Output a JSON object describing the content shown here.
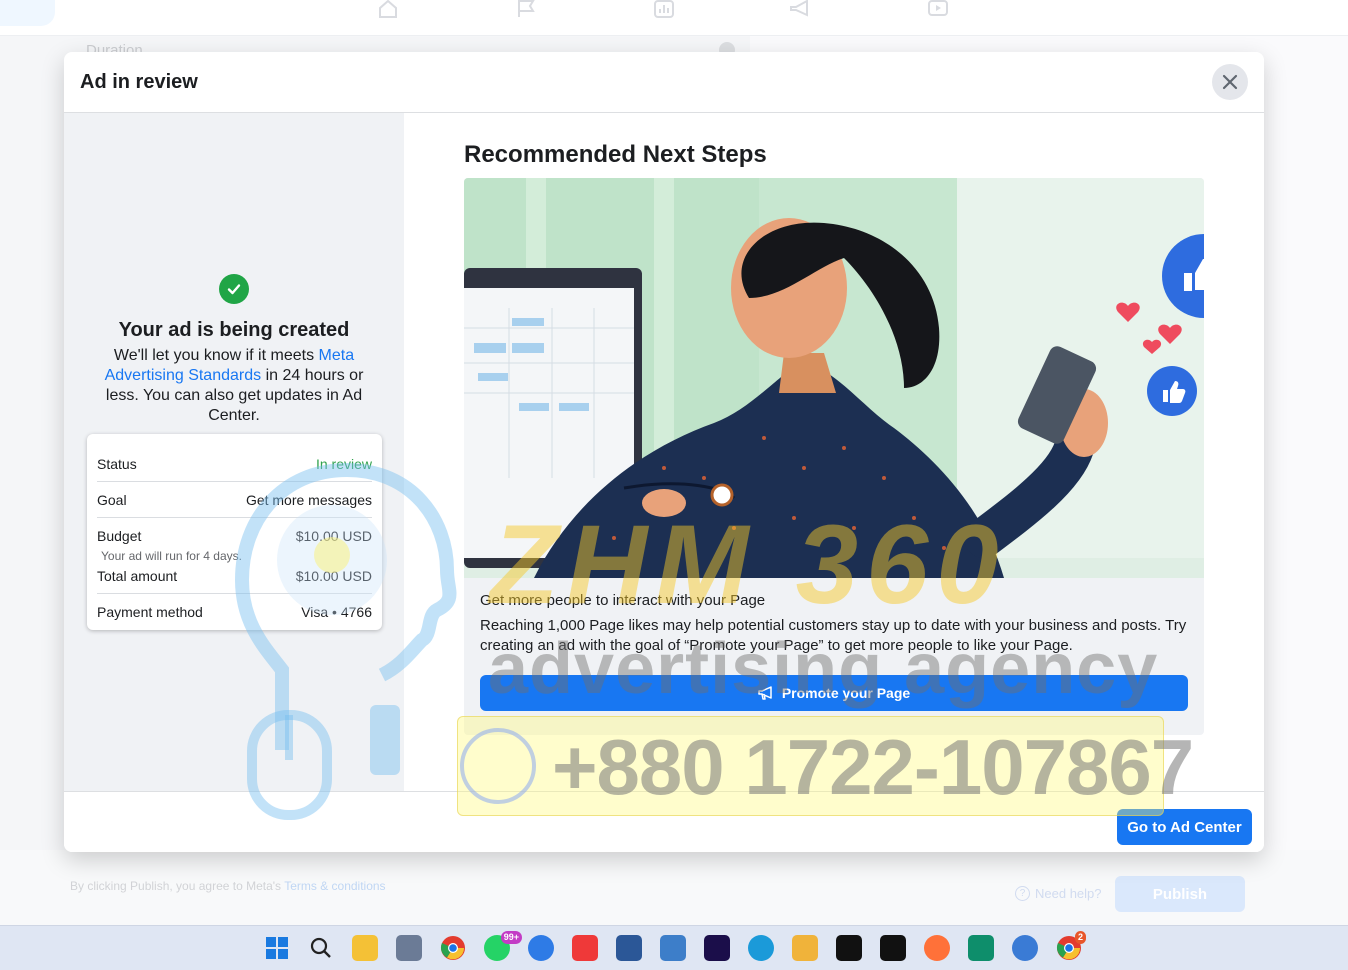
{
  "background": {
    "duration_label": "Duration",
    "terms_prefix": "By clicking Publish, you agree to Meta's ",
    "terms_link": "Terms & conditions",
    "need_help": "Need help?",
    "publish_label": "Publish"
  },
  "modal": {
    "title": "Ad in review",
    "confirmation": {
      "title": "Your ad is being created",
      "desc_before": "We'll let you know if it meets ",
      "desc_link": "Meta Advertising Standards",
      "desc_after": " in 24 hours or less. You can also get updates in Ad Center."
    },
    "summary": {
      "status_label": "Status",
      "status_value": "In review",
      "goal_label": "Goal",
      "goal_value": "Get more messages",
      "budget_label": "Budget",
      "budget_value": "$10.00 USD",
      "budget_note": "Your ad will run for 4 days.",
      "total_label": "Total amount",
      "total_value": "$10.00 USD",
      "payment_label": "Payment method",
      "payment_value": "Visa • 4766"
    },
    "next_steps": {
      "title": "Recommended Next Steps",
      "card_heading": "Get more people to interact with your Page",
      "card_body": "Reaching 1,000 Page likes may help potential customers stay up to date with your business and posts. Try creating an ad with the goal of “Promote your Page” to get more people to like your Page.",
      "button_label": "Promote your Page"
    },
    "footer_button": "Go to Ad Center"
  },
  "watermark": {
    "agency_name": "ZHM 360",
    "agency_tagline": "advertising agency",
    "phone": "+880 1722-107867"
  },
  "taskbar": {
    "whatsapp_badge": "99+",
    "chrome_badge": "2",
    "icons": [
      "windows-start-icon",
      "search-icon",
      "file-explorer-icon",
      "snipping-tool-icon",
      "chrome-icon",
      "whatsapp-icon",
      "app-store-icon",
      "vivaldi-icon",
      "word-icon",
      "notepad-icon",
      "premiere-icon",
      "edge-icon",
      "ms-store-icon",
      "terminal-icon",
      "capcut-icon",
      "firefox-icon",
      "filmora-icon",
      "sync-icon",
      "chrome-profile-icon"
    ]
  },
  "colors": {
    "primary": "#1877f2",
    "success": "#31a24c",
    "check": "#20a546"
  }
}
